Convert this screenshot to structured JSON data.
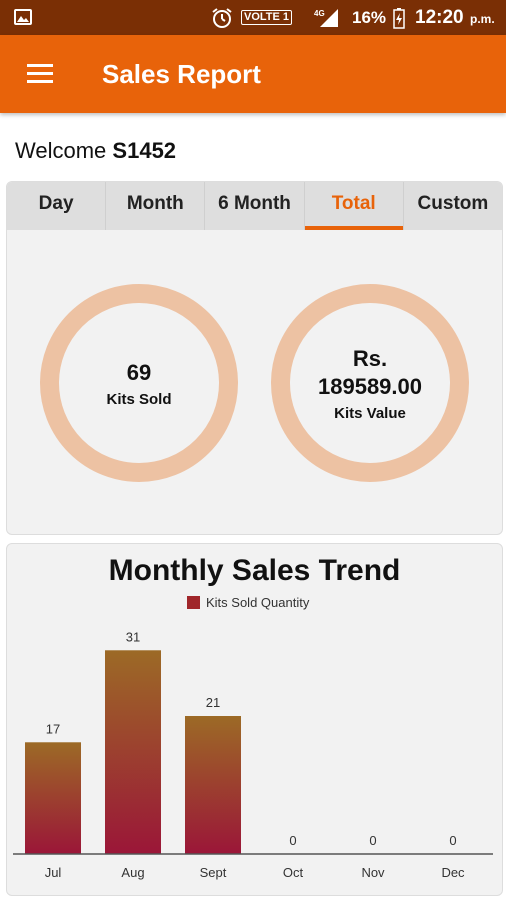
{
  "status_bar": {
    "signal_label": "4G",
    "volte": "VOLTE 1",
    "battery": "16%",
    "time": "12:20",
    "ampm": "p.m."
  },
  "app_bar": {
    "title": "Sales Report"
  },
  "welcome": {
    "prefix": "Welcome",
    "user": "S1452"
  },
  "tabs": [
    {
      "label": "Day"
    },
    {
      "label": "Month"
    },
    {
      "label": "6 Month"
    },
    {
      "label": "Total",
      "active": true
    },
    {
      "label": "Custom"
    }
  ],
  "summary": {
    "kits_sold": {
      "value": "69",
      "label": "Kits Sold"
    },
    "kits_value": {
      "currency": "Rs.",
      "value": "189589.00",
      "label": "Kits Value"
    }
  },
  "colors": {
    "accent": "#e8630a",
    "status_bar": "#7a2f05",
    "ring": "#edc2a3",
    "bar_top": "#9c6a26",
    "bar_bottom": "#9b1638"
  },
  "chart_data": {
    "type": "bar",
    "title": "Monthly Sales Trend",
    "series": [
      {
        "name": "Kits Sold Quantity",
        "values": [
          17,
          31,
          21,
          0,
          0,
          0
        ]
      }
    ],
    "categories": [
      "Jul",
      "Aug",
      "Sept",
      "Oct",
      "Nov",
      "Dec"
    ],
    "ylim": [
      0,
      35
    ],
    "grid": false,
    "legend": "top-center",
    "data_labels": true
  }
}
